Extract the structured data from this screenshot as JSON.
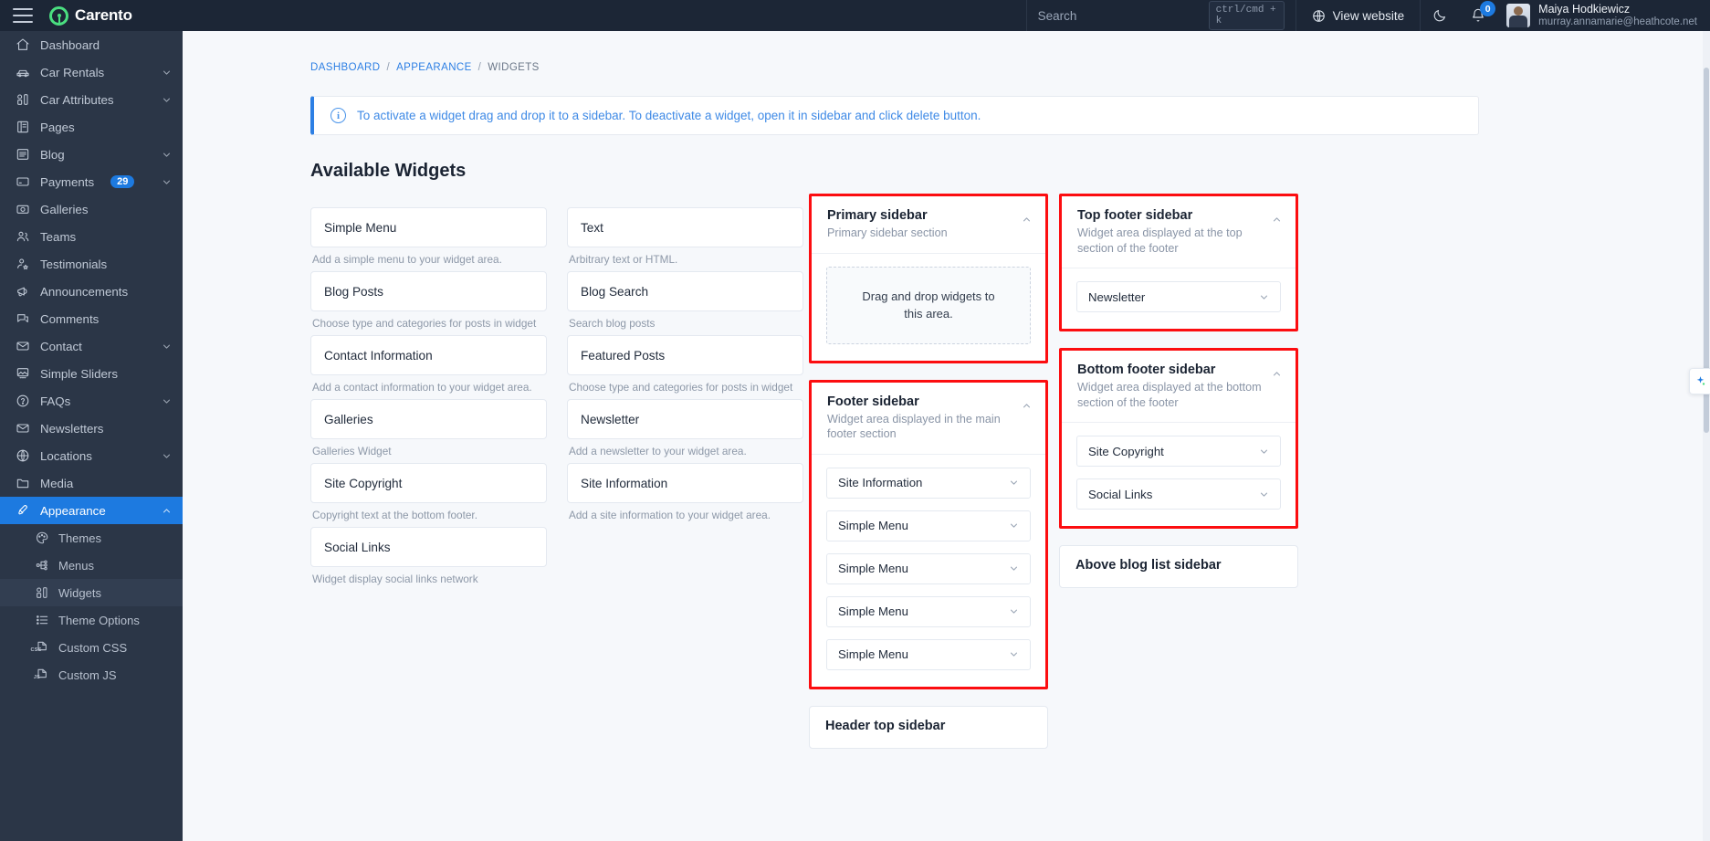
{
  "topbar": {
    "menu_icon": "hamburger-menu-icon",
    "logo_text": "Carento",
    "search_placeholder": "Search",
    "search_value": "",
    "search_shortcut": "ctrl/cmd + k",
    "view_website_label": "View website",
    "theme_toggle_icon": "moon-icon",
    "notifications_icon": "bell-icon",
    "notifications_count": "0",
    "user_name": "Maiya Hodkiewicz",
    "user_email": "murray.annamarie@heathcote.net"
  },
  "sidebar": {
    "items": [
      {
        "label": "Dashboard",
        "icon": "home-icon",
        "chevron": false,
        "active": false
      },
      {
        "label": "Car Rentals",
        "icon": "car-icon",
        "chevron": true,
        "active": false
      },
      {
        "label": "Car Attributes",
        "icon": "attributes-icon",
        "chevron": true,
        "active": false
      },
      {
        "label": "Pages",
        "icon": "pages-icon",
        "chevron": false,
        "active": false
      },
      {
        "label": "Blog",
        "icon": "blog-icon",
        "chevron": true,
        "active": false
      },
      {
        "label": "Payments",
        "icon": "card-icon",
        "chevron": true,
        "active": false,
        "badge": "29"
      },
      {
        "label": "Galleries",
        "icon": "camera-icon",
        "chevron": false,
        "active": false
      },
      {
        "label": "Teams",
        "icon": "users-icon",
        "chevron": false,
        "active": false
      },
      {
        "label": "Testimonials",
        "icon": "user-star-icon",
        "chevron": false,
        "active": false
      },
      {
        "label": "Announcements",
        "icon": "megaphone-icon",
        "chevron": false,
        "active": false
      },
      {
        "label": "Comments",
        "icon": "comment-icon",
        "chevron": false,
        "active": false
      },
      {
        "label": "Contact",
        "icon": "envelope-icon",
        "chevron": true,
        "active": false
      },
      {
        "label": "Simple Sliders",
        "icon": "image-slider-icon",
        "chevron": false,
        "active": false
      },
      {
        "label": "FAQs",
        "icon": "question-icon",
        "chevron": true,
        "active": false
      },
      {
        "label": "Newsletters",
        "icon": "envelope-icon",
        "chevron": false,
        "active": false
      },
      {
        "label": "Locations",
        "icon": "globe-icon",
        "chevron": true,
        "active": false
      },
      {
        "label": "Media",
        "icon": "folder-icon",
        "chevron": false,
        "active": false
      },
      {
        "label": "Appearance",
        "icon": "brush-icon",
        "chevron": true,
        "active": true
      }
    ],
    "sub_items": [
      {
        "label": "Themes",
        "icon": "palette-icon",
        "current": false
      },
      {
        "label": "Menus",
        "icon": "sitemap-icon",
        "current": false
      },
      {
        "label": "Widgets",
        "icon": "widgets-icon",
        "current": true
      },
      {
        "label": "Theme Options",
        "icon": "list-icon",
        "current": false
      },
      {
        "label": "Custom CSS",
        "icon": "css-file-icon",
        "current": false
      },
      {
        "label": "Custom JS",
        "icon": "js-file-icon",
        "current": false
      }
    ]
  },
  "breadcrumb": {
    "items": [
      "DASHBOARD",
      "APPEARANCE",
      "WIDGETS"
    ],
    "separator": "/"
  },
  "alert": {
    "icon": "info-icon",
    "text": "To activate a widget drag and drop it to a sidebar. To deactivate a widget, open it in sidebar and click delete button."
  },
  "available_widgets": {
    "title": "Available Widgets",
    "items": [
      {
        "name": "Simple Menu",
        "description": "Add a simple menu to your widget area."
      },
      {
        "name": "Text",
        "description": "Arbitrary text or HTML."
      },
      {
        "name": "Blog Posts",
        "description": "Choose type and categories for posts in widget"
      },
      {
        "name": "Blog Search",
        "description": "Search blog posts"
      },
      {
        "name": "Contact Information",
        "description": "Add a contact information to your widget area."
      },
      {
        "name": "Featured Posts",
        "description": "Choose type and categories for posts in widget"
      },
      {
        "name": "Galleries",
        "description": "Galleries Widget"
      },
      {
        "name": "Newsletter",
        "description": "Add a newsletter to your widget area."
      },
      {
        "name": "Site Copyright",
        "description": "Copyright text at the bottom footer."
      },
      {
        "name": "Site Information",
        "description": "Add a site information to your widget area."
      },
      {
        "name": "Social Links",
        "description": "Widget display social links network"
      }
    ]
  },
  "sidebar_panels": {
    "column_left": [
      {
        "title": "Primary sidebar",
        "subtitle": "Primary sidebar section",
        "highlighted": true,
        "collapse_icon": "chevron-up-icon",
        "dropzone_text": "Drag and drop widgets to this area.",
        "widgets": []
      },
      {
        "title": "Footer sidebar",
        "subtitle": "Widget area displayed in the main footer section",
        "highlighted": true,
        "collapse_icon": "chevron-up-icon",
        "dropzone_text": "",
        "widgets": [
          "Site Information",
          "Simple Menu",
          "Simple Menu",
          "Simple Menu",
          "Simple Menu"
        ]
      },
      {
        "title": "Header top sidebar",
        "subtitle": "",
        "highlighted": false,
        "collapse_icon": "chevron-up-icon",
        "dropzone_text": "",
        "widgets": []
      }
    ],
    "column_right": [
      {
        "title": "Top footer sidebar",
        "subtitle": "Widget area displayed at the top section of the footer",
        "highlighted": true,
        "collapse_icon": "chevron-up-icon",
        "dropzone_text": "",
        "widgets": [
          "Newsletter"
        ]
      },
      {
        "title": "Bottom footer sidebar",
        "subtitle": "Widget area displayed at the bottom section of the footer",
        "highlighted": true,
        "collapse_icon": "chevron-up-icon",
        "dropzone_text": "",
        "widgets": [
          "Site Copyright",
          "Social Links"
        ]
      },
      {
        "title": "Above blog list sidebar",
        "subtitle": "",
        "highlighted": false,
        "collapse_icon": "chevron-up-icon",
        "dropzone_text": "",
        "widgets": []
      }
    ]
  },
  "float_tab": {
    "icon": "sparkle-icon"
  },
  "colors": {
    "accent": "#1d7ae0",
    "highlight_border": "#fc0d10",
    "sidebar_bg": "#2b3647",
    "topbar_bg": "#1c2636",
    "page_bg": "#f6f8fb",
    "logo_green": "#4ade80"
  }
}
